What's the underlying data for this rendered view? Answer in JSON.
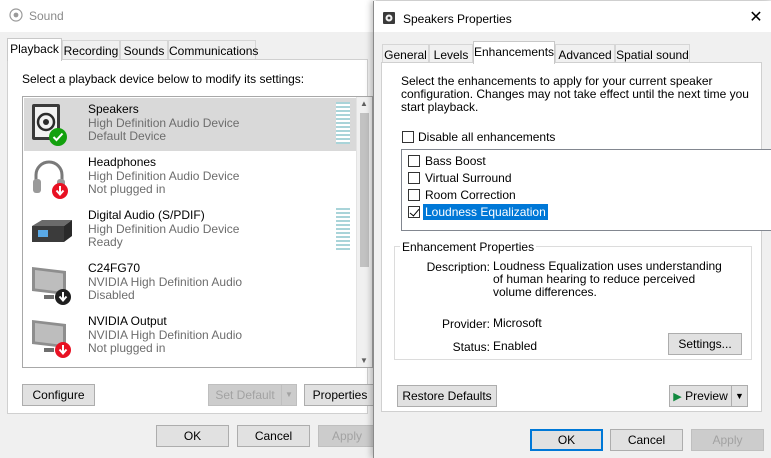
{
  "sound": {
    "title": "Sound",
    "tabs": [
      "Playback",
      "Recording",
      "Sounds",
      "Communications"
    ],
    "instruction": "Select a playback device below to modify its settings:",
    "devices": [
      {
        "name": "Speakers",
        "sub": "High Definition Audio Device",
        "status": "Default Device"
      },
      {
        "name": "Headphones",
        "sub": "High Definition Audio Device",
        "status": "Not plugged in"
      },
      {
        "name": "Digital Audio (S/PDIF)",
        "sub": "High Definition Audio Device",
        "status": "Ready"
      },
      {
        "name": "C24FG70",
        "sub": "NVIDIA High Definition Audio",
        "status": "Disabled"
      },
      {
        "name": "NVIDIA Output",
        "sub": "NVIDIA High Definition Audio",
        "status": "Not plugged in"
      }
    ],
    "buttons": {
      "configure": "Configure",
      "set_default": "Set Default",
      "properties": "Properties",
      "ok": "OK",
      "cancel": "Cancel",
      "apply": "Apply"
    }
  },
  "props": {
    "title": "Speakers Properties",
    "close": "✕",
    "tabs": [
      "General",
      "Levels",
      "Enhancements",
      "Advanced",
      "Spatial sound"
    ],
    "description": "Select the enhancements to apply for your current speaker configuration. Changes may not take effect until the next time you start playback.",
    "disable_all": "Disable all enhancements",
    "enhancements": [
      {
        "label": "Bass Boost",
        "checked": false
      },
      {
        "label": "Virtual Surround",
        "checked": false
      },
      {
        "label": "Room Correction",
        "checked": false
      },
      {
        "label": "Loudness Equalization",
        "checked": true
      }
    ],
    "enh_props": {
      "title": "Enhancement Properties",
      "description_label": "Description:",
      "description_value": "Loudness Equalization uses understanding of human hearing to reduce perceived volume differences.",
      "provider_label": "Provider:",
      "provider_value": "Microsoft",
      "status_label": "Status:",
      "status_value": "Enabled",
      "settings_button": "Settings..."
    },
    "buttons": {
      "restore": "Restore Defaults",
      "preview": "Preview",
      "ok": "OK",
      "cancel": "Cancel",
      "apply": "Apply"
    }
  },
  "colors": {
    "selection": "#0078d7",
    "ok_check": "#13a10e",
    "unplugged": "#e81123",
    "preview_play": "#10893e"
  }
}
